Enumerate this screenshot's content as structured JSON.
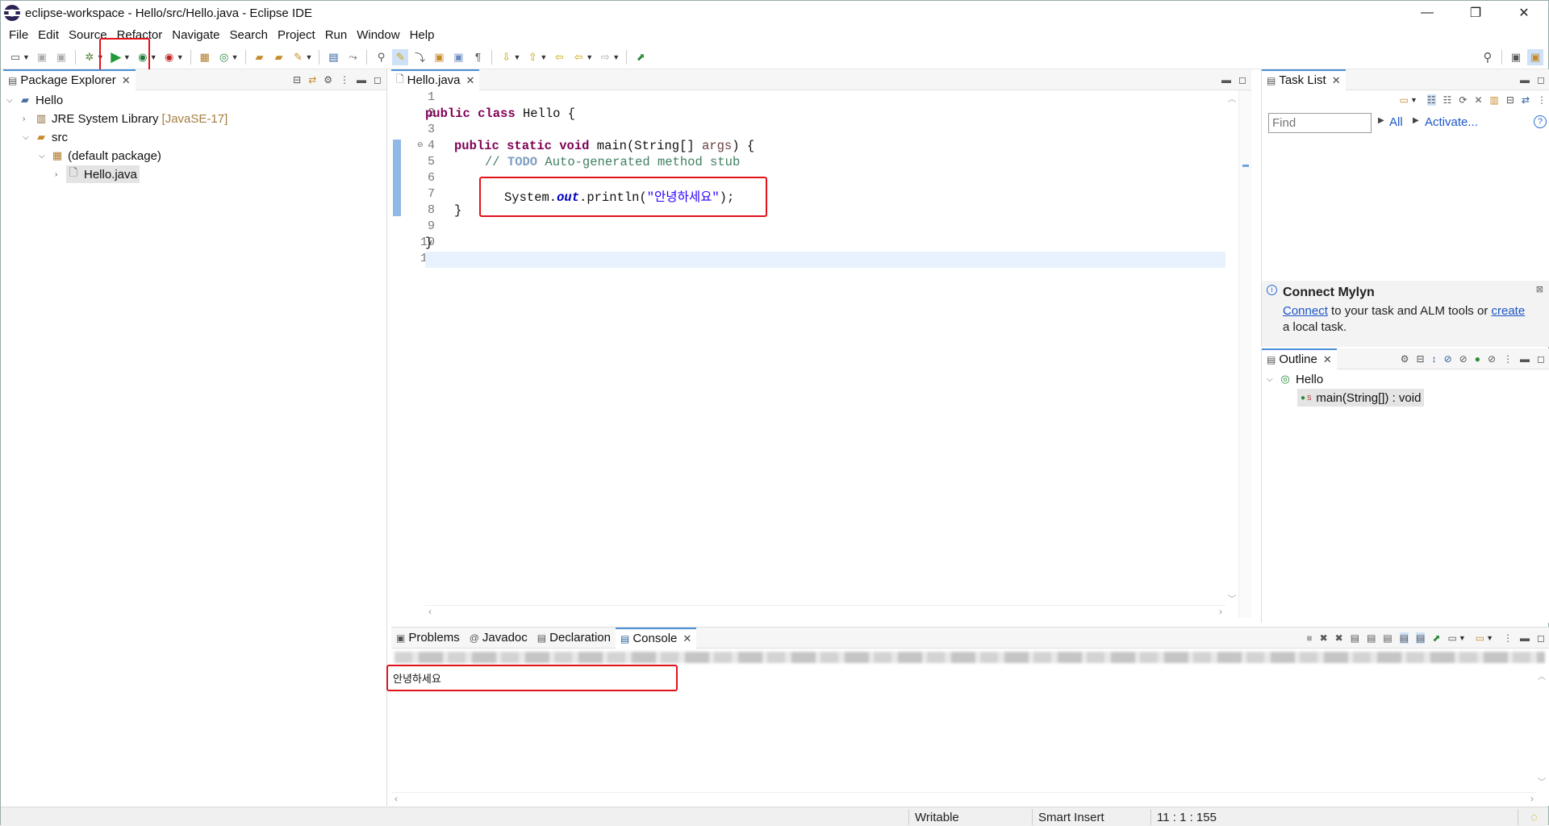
{
  "window": {
    "title": "eclipse-workspace - Hello/src/Hello.java - Eclipse IDE",
    "controls": {
      "minimize": "—",
      "restore": "❐",
      "close": "✕"
    }
  },
  "menubar": [
    "File",
    "Edit",
    "Source",
    "Refactor",
    "Navigate",
    "Search",
    "Project",
    "Run",
    "Window",
    "Help"
  ],
  "package_explorer": {
    "tab_label": "Package Explorer",
    "tree": [
      {
        "label": "Hello",
        "decoration": ""
      },
      {
        "label": "JRE System Library",
        "decoration": "[JavaSE-17]"
      },
      {
        "label": "src",
        "decoration": ""
      },
      {
        "label": "(default package)",
        "decoration": ""
      },
      {
        "label": "Hello.java",
        "decoration": ""
      }
    ]
  },
  "editor": {
    "tab_label": "Hello.java",
    "line_numbers": [
      "1",
      "2",
      "3",
      "4",
      "5",
      "6",
      "7",
      "8",
      "9",
      "10",
      "11"
    ],
    "code": {
      "l2_kw1": "public",
      "l2_kw2": "class",
      "l2_rest": " Hello {",
      "l4_kw1": "public",
      "l4_kw2": "static",
      "l4_kw3": "void",
      "l4_mid": " main(String[] ",
      "l4_param": "args",
      "l4_end": ") {",
      "l5_comment": "// ",
      "l5_todo": "TODO",
      "l5_rest": " Auto-generated method stub",
      "l7_pre": "System.",
      "l7_field": "out",
      "l7_mid": ".println(",
      "l7_str": "\"안녕하세요\"",
      "l7_end": ");",
      "l8": "}",
      "l10": "}"
    }
  },
  "task_list": {
    "tab_label": "Task List",
    "find_placeholder": "Find",
    "all_label": "All",
    "activate_label": "Activate...",
    "help_glyph": "?"
  },
  "mylyn": {
    "title": "Connect Mylyn",
    "connect_link": "Connect",
    "text_mid": " to your task and ALM tools or ",
    "create_link": "create",
    "text_end": "a local task."
  },
  "outline": {
    "tab_label": "Outline",
    "class_label": "Hello",
    "method_label": "main(String[]) : void",
    "static_marker": "S"
  },
  "bottom_panel": {
    "tabs": [
      "Problems",
      "Javadoc",
      "Declaration",
      "Console"
    ],
    "active_tab": "Console",
    "console_output": "안녕하세요"
  },
  "status": {
    "writable": "Writable",
    "insert_mode": "Smart Insert",
    "position": "11 : 1 : 155"
  },
  "colors": {
    "accent": "#4a8fd6",
    "highlight_box": "#e0131b",
    "keyword": "#7f0055",
    "string": "#2a00ff",
    "comment": "#3f7f5f"
  }
}
